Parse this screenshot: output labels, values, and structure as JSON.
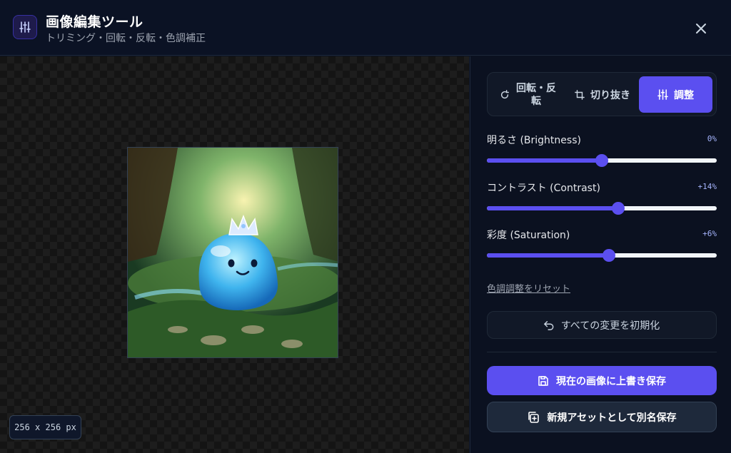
{
  "header": {
    "title": "画像編集ツール",
    "subtitle": "トリミング・回転・反転・色調補正",
    "app_icon": "sliders-icon",
    "close_icon": "close-icon"
  },
  "canvas": {
    "dimensions_label": "256 x 256 px"
  },
  "tabs": [
    {
      "label": "回転・反転",
      "icon": "rotate-icon",
      "active": false
    },
    {
      "label": "切り抜き",
      "icon": "crop-icon",
      "active": false
    },
    {
      "label": "調整",
      "icon": "sliders-icon",
      "active": true
    }
  ],
  "adjustments": {
    "brightness": {
      "label": "明るさ (Brightness)",
      "value_label": "0%",
      "value": 0,
      "min": -100,
      "max": 100
    },
    "contrast": {
      "label": "コントラスト (Contrast)",
      "value_label": "+14%",
      "value": 14,
      "min": -100,
      "max": 100
    },
    "saturation": {
      "label": "彩度 (Saturation)",
      "value_label": "+6%",
      "value": 6,
      "min": -100,
      "max": 100
    }
  },
  "actions": {
    "reset_color_link": "色調調整をリセット",
    "reset_all_label": "すべての変更を初期化",
    "save_overwrite_label": "現在の画像に上書き保存",
    "save_as_new_label": "新規アセットとして別名保存"
  },
  "colors": {
    "accent": "#5b4ff0",
    "background": "#0b1120"
  }
}
